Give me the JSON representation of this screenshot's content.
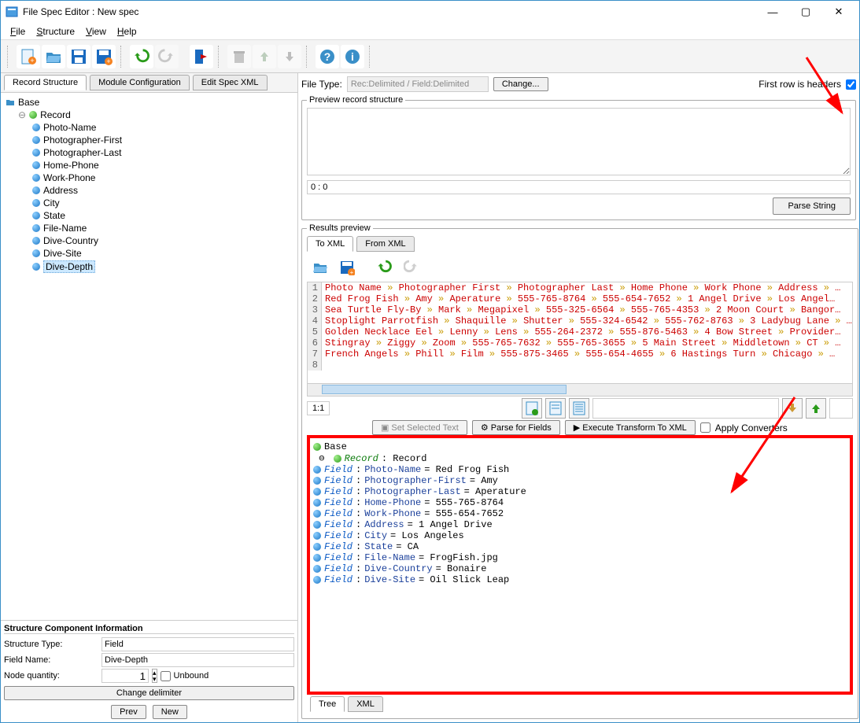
{
  "window": {
    "title": "File Spec Editor : New spec"
  },
  "menus": {
    "file": "File",
    "structure": "Structure",
    "view": "View",
    "help": "Help"
  },
  "tabs_left": {
    "record_structure": "Record Structure",
    "module_config": "Module Configuration",
    "edit_spec_xml": "Edit Spec XML"
  },
  "tree": {
    "root": "Base",
    "record": "Record",
    "fields": [
      "Photo-Name",
      "Photographer-First",
      "Photographer-Last",
      "Home-Phone",
      "Work-Phone",
      "Address",
      "City",
      "State",
      "File-Name",
      "Dive-Country",
      "Dive-Site",
      "Dive-Depth"
    ]
  },
  "info": {
    "heading": "Structure Component Information",
    "structure_type_label": "Structure Type:",
    "structure_type_value": "Field",
    "field_name_label": "Field Name:",
    "field_name_value": "Dive-Depth",
    "node_qty_label": "Node quantity:",
    "node_qty_value": "1",
    "unbound_label": "Unbound",
    "change_delim": "Change delimiter",
    "prev": "Prev",
    "new": "New"
  },
  "right": {
    "file_type_label": "File Type:",
    "file_type_value": "Rec:Delimited / Field:Delimited",
    "change": "Change...",
    "first_row": "First row is headers",
    "preview_legend": "Preview record structure",
    "preview_status": "0 : 0",
    "parse_string": "Parse String",
    "results_legend": "Results preview",
    "results_tabs": {
      "to_xml": "To XML",
      "from_xml": "From XML"
    },
    "pos": "1:1",
    "set_selected": "Set Selected Text",
    "parse_fields": "Parse for Fields",
    "execute": "Execute Transform To XML",
    "apply_conv": "Apply Converters",
    "bottom_tabs": {
      "tree": "Tree",
      "xml": "XML"
    }
  },
  "code_lines": [
    [
      "Photo Name",
      "Photographer First",
      "Photographer Last",
      "Home Phone",
      "Work Phone",
      "Address",
      "…"
    ],
    [
      "Red Frog Fish",
      "Amy",
      "Aperature",
      "555-765-8764",
      "555-654-7652",
      "1 Angel Drive",
      "Los Angel…"
    ],
    [
      "Sea Turtle Fly-By",
      "Mark",
      "Megapixel",
      "555-325-6564",
      "555-765-4353",
      "2 Moon Court",
      "Bangor…"
    ],
    [
      "Stoplight Parrotfish",
      "Shaquille",
      "Shutter",
      "555-324-6542",
      "555-762-8763",
      "3 Ladybug Lane",
      "…"
    ],
    [
      "Golden Necklace Eel",
      "Lenny",
      "Lens",
      "555-264-2372",
      "555-876-5463",
      "4 Bow Street",
      "Provider…"
    ],
    [
      "Stingray",
      "Ziggy",
      "Zoom",
      "555-765-7632",
      "555-765-3655",
      "5 Main Street",
      "Middletown",
      "CT",
      "…"
    ],
    [
      "French Angels",
      "Phill",
      "Film",
      "555-875-3465",
      "555-654-4655",
      "6 Hastings Turn",
      "Chicago",
      "…"
    ],
    [
      ""
    ]
  ],
  "output": {
    "base": "Base",
    "record_label": "Record",
    "record_name": "Record",
    "field_label": "Field",
    "rows": [
      {
        "name": "Photo-Name",
        "value": "Red Frog Fish"
      },
      {
        "name": "Photographer-First",
        "value": "Amy"
      },
      {
        "name": "Photographer-Last",
        "value": "Aperature"
      },
      {
        "name": "Home-Phone",
        "value": "555-765-8764"
      },
      {
        "name": "Work-Phone",
        "value": "555-654-7652"
      },
      {
        "name": "Address",
        "value": "1 Angel Drive"
      },
      {
        "name": "City",
        "value": "Los Angeles"
      },
      {
        "name": "State",
        "value": "CA"
      },
      {
        "name": "File-Name",
        "value": "FrogFish.jpg"
      },
      {
        "name": "Dive-Country",
        "value": "Bonaire"
      },
      {
        "name": "Dive-Site",
        "value": "Oil Slick Leap"
      }
    ]
  }
}
